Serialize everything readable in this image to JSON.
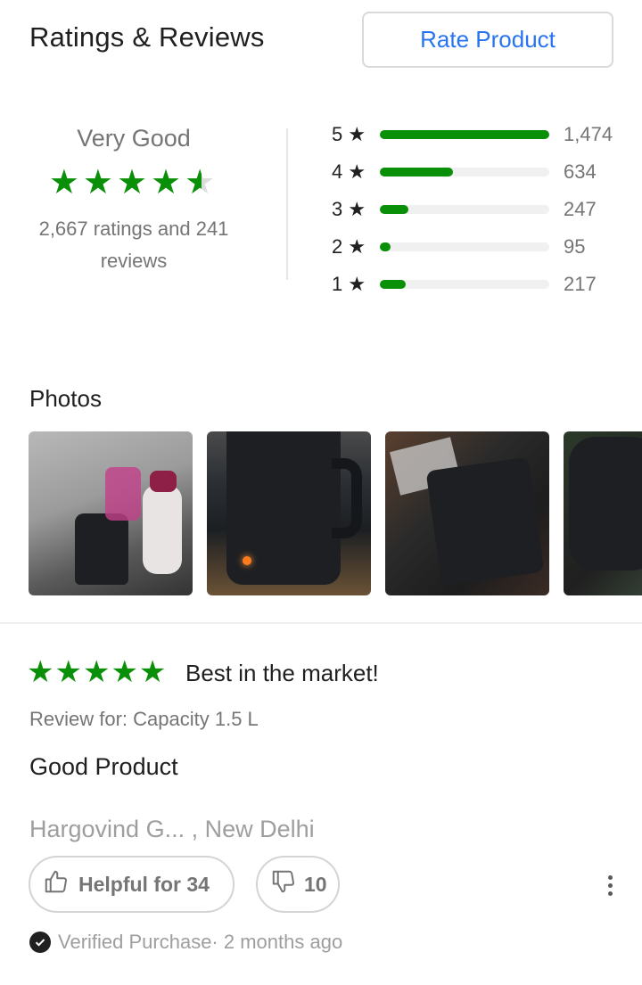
{
  "header": {
    "title": "Ratings & Reviews",
    "rate_button": "Rate Product"
  },
  "summary": {
    "label": "Very Good",
    "stars": "★★★★",
    "half_star": "★",
    "rating_value": 4.3,
    "counts_text": "2,667 ratings and 241 reviews",
    "accent_color": "#0a8f08"
  },
  "distribution": [
    {
      "star": "5 ★",
      "count": "1,474",
      "fraction": 1.0
    },
    {
      "star": "4 ★",
      "count": "634",
      "fraction": 0.43
    },
    {
      "star": "3 ★",
      "count": "247",
      "fraction": 0.17
    },
    {
      "star": "2 ★",
      "count": "95",
      "fraction": 0.065
    },
    {
      "star": "1 ★",
      "count": "217",
      "fraction": 0.15
    }
  ],
  "photos": {
    "title": "Photos"
  },
  "review": {
    "stars": "★★★★★",
    "title": "Best in the market!",
    "review_for": "Review for: Capacity 1.5 L",
    "text": "Good Product",
    "reviewer": "Hargovind G... , New Delhi",
    "helpful_label": "Helpful for 34",
    "dislike_count": "10",
    "verified": "Verified Purchase· 2 months ago"
  }
}
